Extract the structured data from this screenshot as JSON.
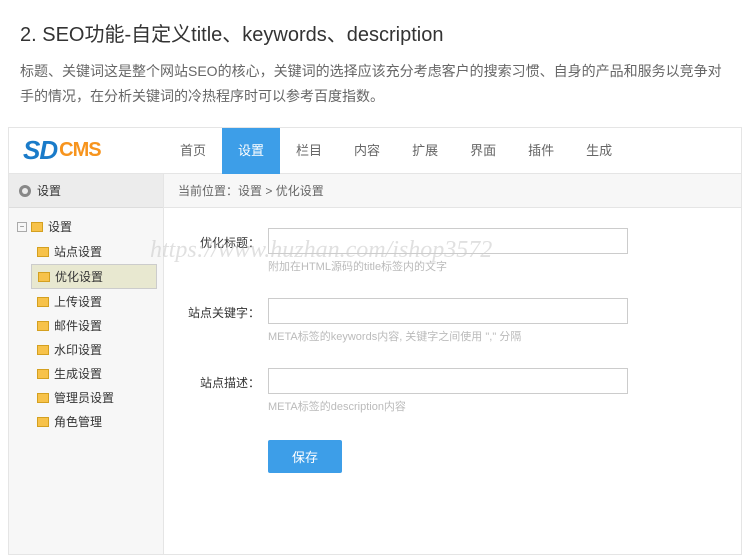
{
  "heading": "2. SEO功能-自定义title、keywords、description",
  "desc": "标题、关键词这是整个网站SEO的核心，关键词的选择应该充分考虑客户的搜索习惯、自身的产品和服务以竞争对手的情况，在分析关键词的冷热程序时可以参考百度指数。",
  "logo": {
    "sd": "SD",
    "cms": "CMS"
  },
  "nav": {
    "items": [
      "首页",
      "设置",
      "栏目",
      "内容",
      "扩展",
      "界面",
      "插件",
      "生成"
    ],
    "activeIndex": 1
  },
  "sidebar": {
    "title": "设置",
    "root": "设置",
    "items": [
      "站点设置",
      "优化设置",
      "上传设置",
      "邮件设置",
      "水印设置",
      "生成设置",
      "管理员设置",
      "角色管理"
    ],
    "selectedIndex": 1
  },
  "crumb": {
    "prefix": "当前位置：",
    "a": "设置",
    "sep": " > ",
    "b": "优化设置"
  },
  "form": {
    "title": {
      "label": "优化标题：",
      "value": "",
      "hint": "附加在HTML源码的title标签内的文字"
    },
    "keywords": {
      "label": "站点关键字：",
      "value": "",
      "hint": "META标签的keywords内容, 关键字之间使用 \",\" 分隔"
    },
    "description": {
      "label": "站点描述：",
      "value": "",
      "hint": "META标签的description内容"
    },
    "save": "保存"
  },
  "watermark": "https://www.huzhan.com/ishop3572"
}
